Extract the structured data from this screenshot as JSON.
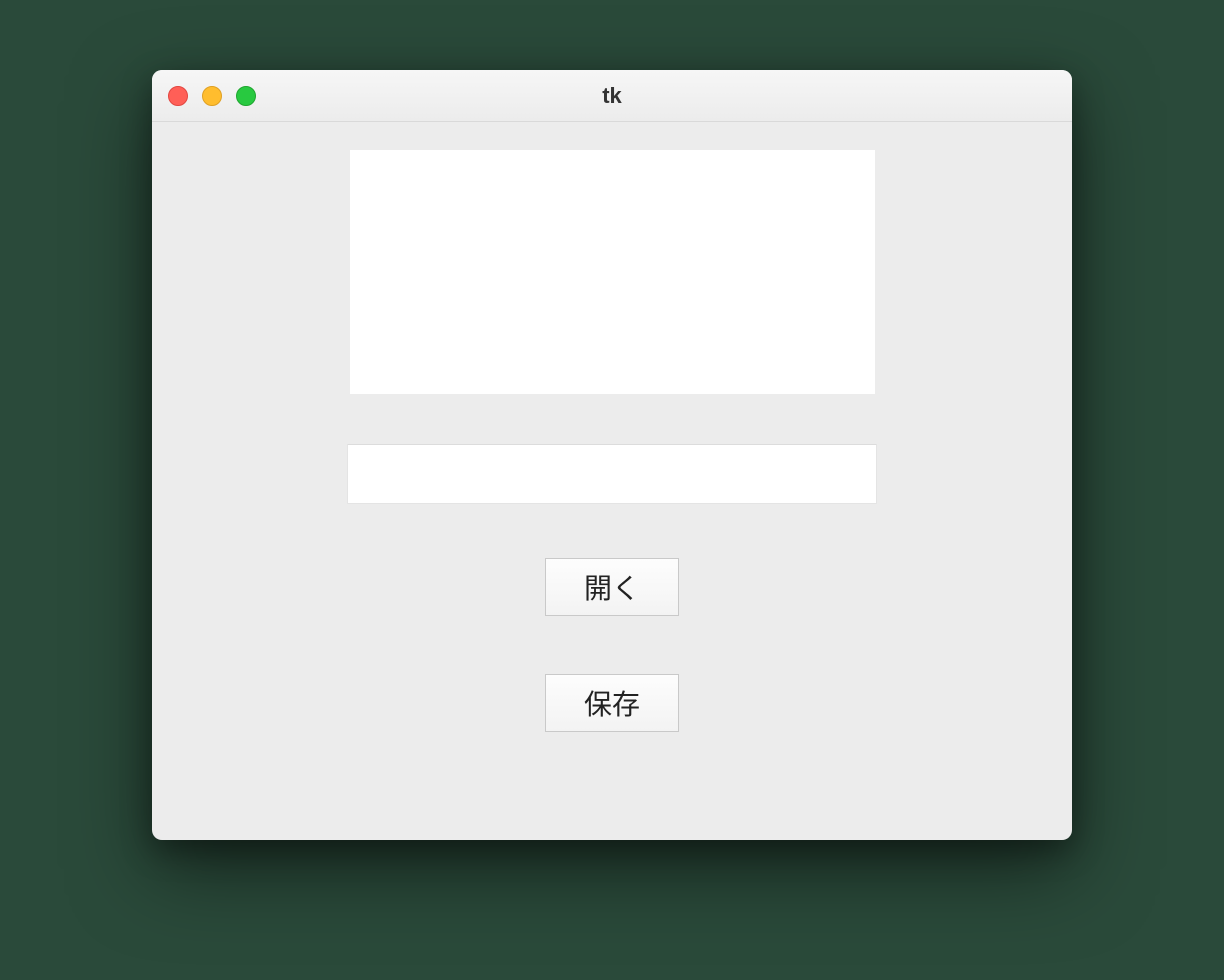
{
  "window": {
    "title": "tk"
  },
  "main": {
    "textarea_value": "",
    "entry_value": "",
    "open_label": "開く",
    "save_label": "保存"
  }
}
